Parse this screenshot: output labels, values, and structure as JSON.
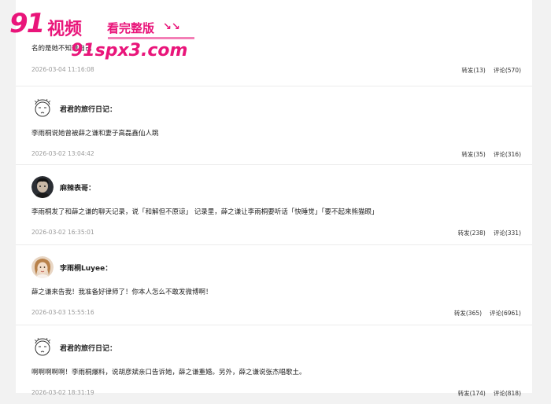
{
  "watermark": {
    "brand_num": "91",
    "brand_cn": "视频",
    "tag": "看完整版",
    "arrows": "↘↘",
    "url": "91spx3.com"
  },
  "posts": [
    {
      "username": "",
      "content": "名的是她不知道自己",
      "time": "2026-03-04 11:16:08",
      "repost": "转发(13)",
      "comment": "评论(570)",
      "avatar": "none"
    },
    {
      "username": "君君的旅行日记：",
      "content": "李雨桐说她曾被薛之谦和妻子高磊鑫仙人跳",
      "time": "2026-03-02 13:04:42",
      "repost": "转发(35)",
      "comment": "评论(316)",
      "avatar": "sketch-face-icon"
    },
    {
      "username": "麻辣表哥：",
      "content": "李雨桐发了和薛之谦的聊天记录，说「和解但不原谅」 记录里，薛之谦让李雨桐要听话「快睡觉」「要不起来熊猫眼」",
      "time": "2026-03-02 16:35:01",
      "repost": "转发(238)",
      "comment": "评论(331)",
      "avatar": "dark-portrait"
    },
    {
      "username": "李雨桐Luyee：",
      "content": "薛之谦来告我！我准备好律师了！你本人怎么不敢发微博啊！",
      "time": "2026-03-03 15:55:16",
      "repost": "转发(365)",
      "comment": "评论(6961)",
      "avatar": "woman-portrait"
    },
    {
      "username": "君君的旅行日记：",
      "content": "啊啊啊啊啊！李雨桐爆料，说胡彦斌亲口告诉她，薛之谦重婚。另外，薛之谦说张杰唱歌土。",
      "time": "2026-03-02 18:31:19",
      "repost": "转发(174)",
      "comment": "评论(818)",
      "avatar": "sketch-face-icon"
    }
  ]
}
